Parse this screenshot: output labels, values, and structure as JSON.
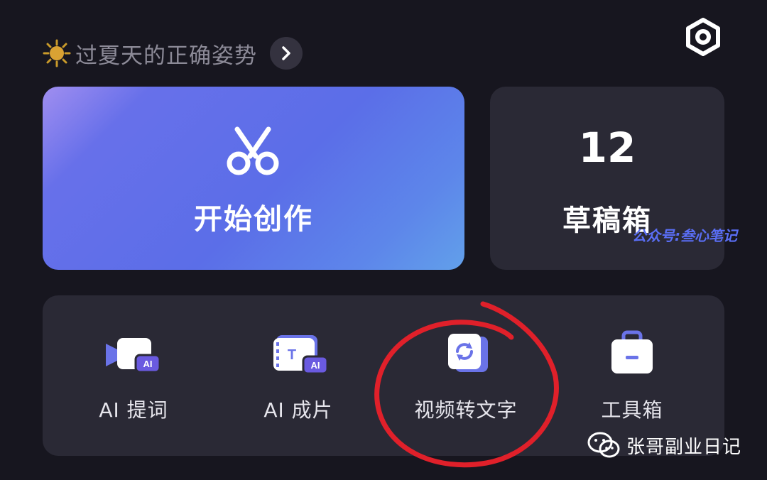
{
  "banner": {
    "text": "过夏天的正确姿势"
  },
  "create_card": {
    "label": "开始创作"
  },
  "drafts_card": {
    "count": "12",
    "label": "草稿箱"
  },
  "tools": [
    {
      "label": "AI 提词",
      "icon": "ai-teleprompter-icon"
    },
    {
      "label": "AI 成片",
      "icon": "ai-video-icon"
    },
    {
      "label": "视频转文字",
      "icon": "video-to-text-icon"
    },
    {
      "label": "工具箱",
      "icon": "toolbox-icon"
    }
  ],
  "watermarks": {
    "top": "公众号:叁心笔记",
    "bottom": "张哥副业日记"
  },
  "colors": {
    "background": "#17161f",
    "card": "#2a2935",
    "accent_gradient_start": "#6770ea",
    "accent_gradient_end": "#62a0ea",
    "highlight": "#e0202a"
  }
}
